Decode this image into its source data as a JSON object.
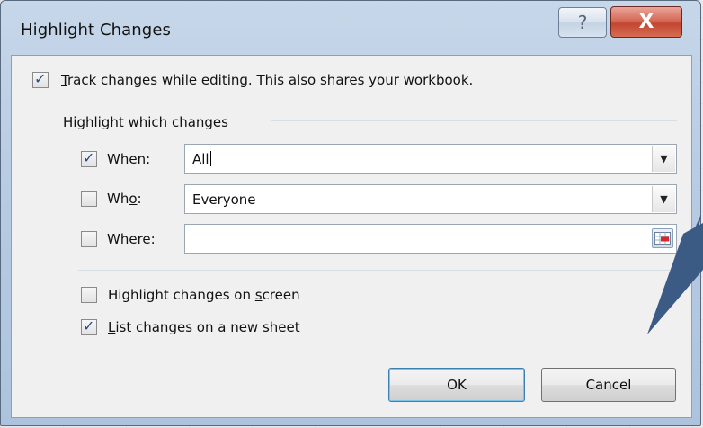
{
  "dialog": {
    "title": "Highlight Changes",
    "help_symbol": "?",
    "close_symbol": "X"
  },
  "track": {
    "checked": true,
    "label_key": "T",
    "label_rest": "rack changes while editing. This also shares your workbook."
  },
  "highlight_group": {
    "heading": "Highlight which changes",
    "when": {
      "checked": true,
      "label_pre": "Whe",
      "label_key": "n",
      "label_post": ":",
      "value": "All"
    },
    "who": {
      "checked": false,
      "label_pre": "Wh",
      "label_key": "o",
      "label_post": ":",
      "value": "Everyone"
    },
    "where": {
      "checked": false,
      "label_pre": "Whe",
      "label_key": "r",
      "label_post": "e:",
      "value": ""
    }
  },
  "options": {
    "on_screen": {
      "checked": false,
      "label_pre": "Highlight changes on ",
      "label_key": "s",
      "label_post": "creen"
    },
    "new_sheet": {
      "checked": true,
      "label_key": "L",
      "label_post": "ist changes on a new sheet"
    }
  },
  "buttons": {
    "ok": "OK",
    "cancel": "Cancel"
  },
  "icons": {
    "checkmark": "check-icon",
    "dropdown": "chevron-down-icon",
    "range_picker": "range-select-icon"
  },
  "colors": {
    "callout": "#3b5a84",
    "close_button": "#c24631",
    "titlebar": "#b8cce3"
  }
}
